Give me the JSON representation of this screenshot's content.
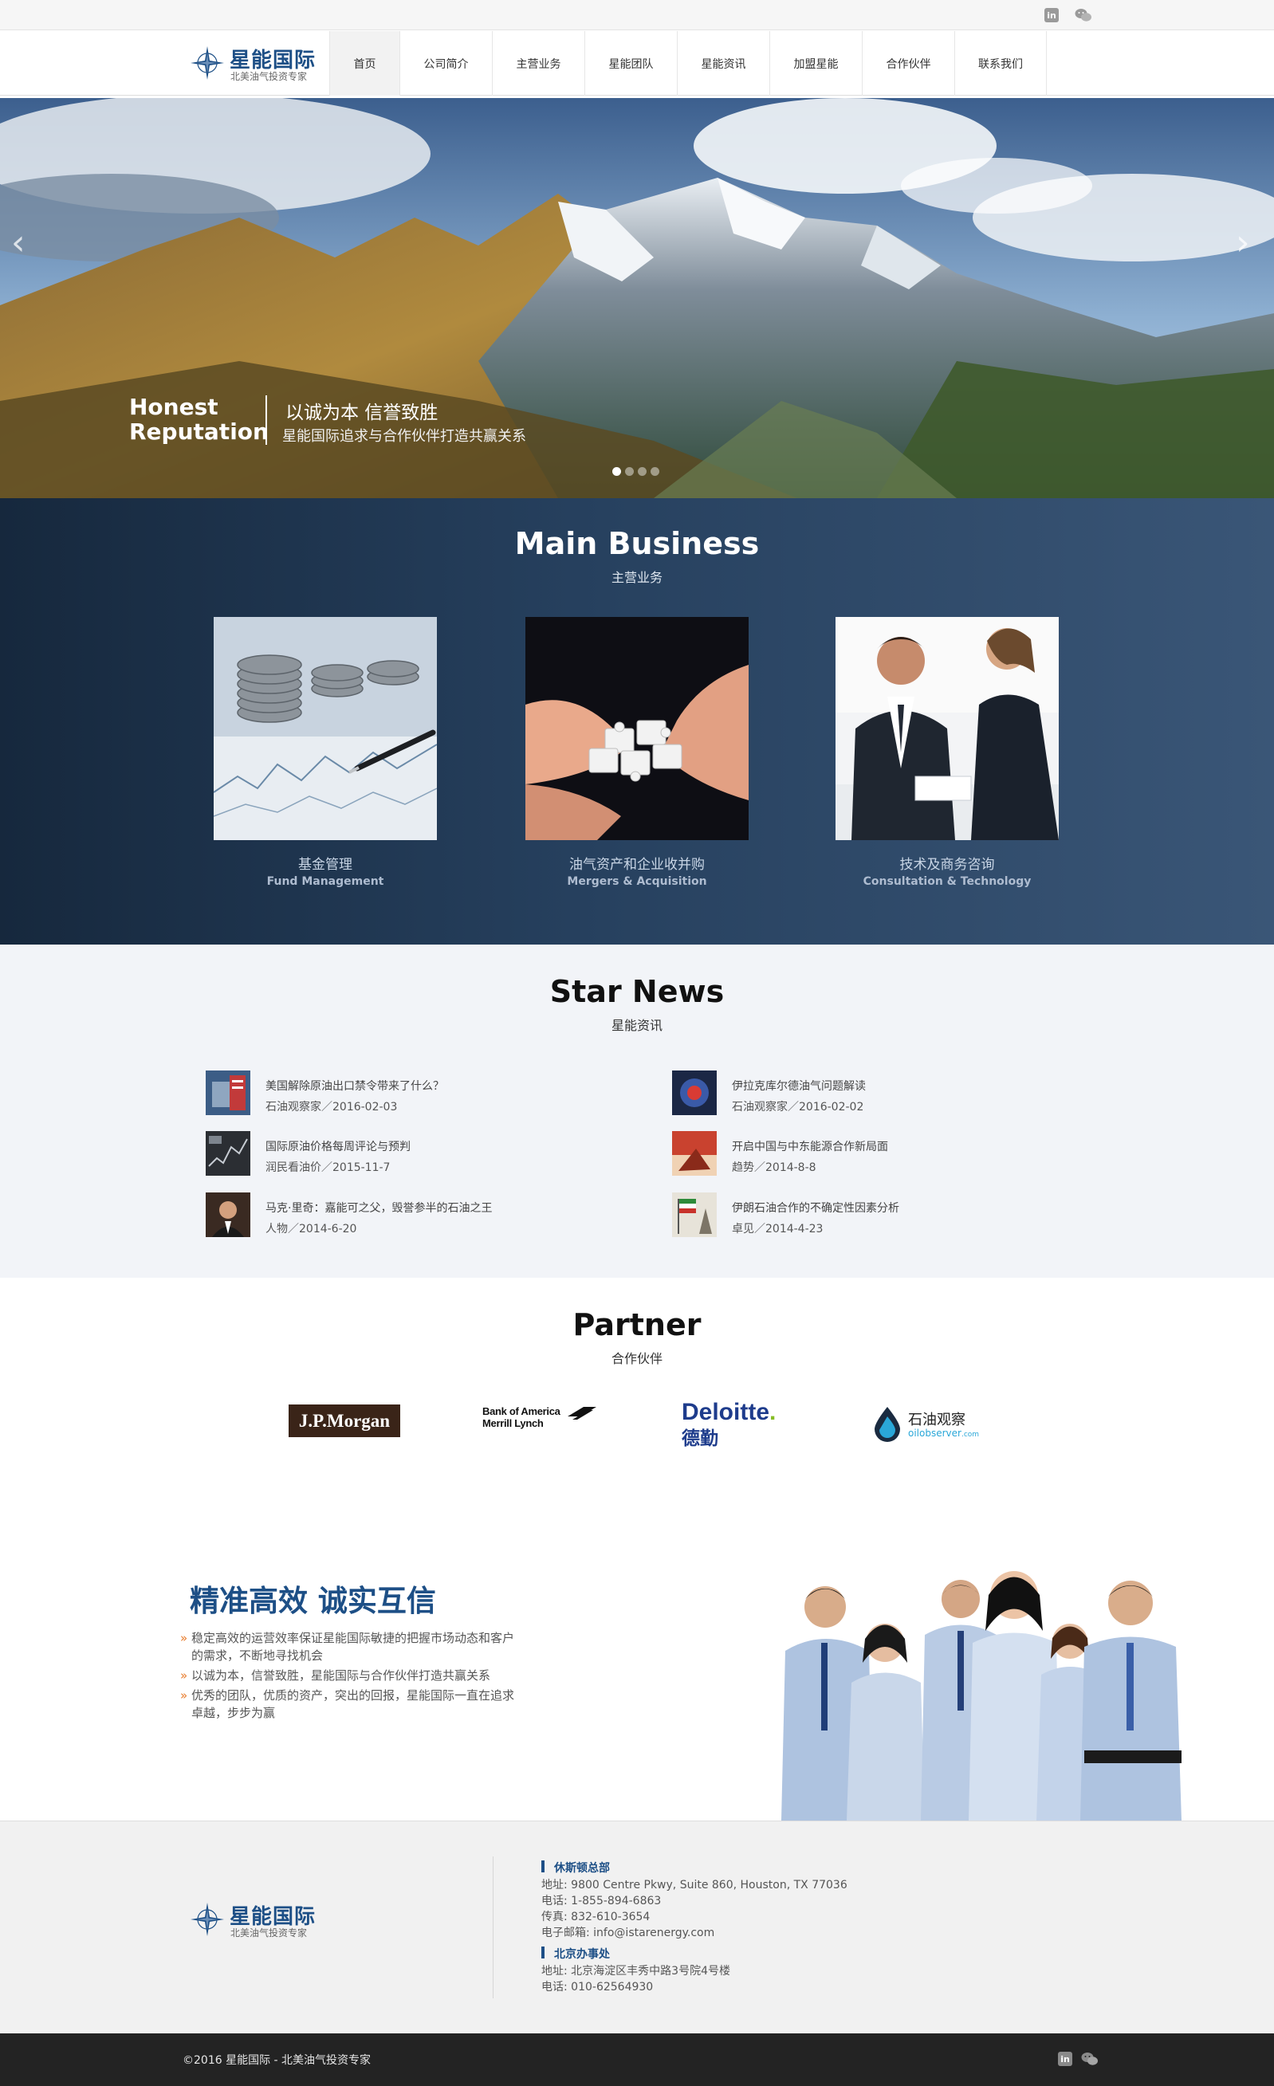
{
  "topbar": {
    "linkedin_icon_label": "in"
  },
  "brand": {
    "title": "星能国际",
    "subtitle": "北美油气投资专家"
  },
  "nav": {
    "items": [
      {
        "label": "首页",
        "active": true
      },
      {
        "label": "公司简介"
      },
      {
        "label": "主营业务"
      },
      {
        "label": "星能团队"
      },
      {
        "label": "星能资讯"
      },
      {
        "label": "加盟星能"
      },
      {
        "label": "合作伙伴"
      },
      {
        "label": "联系我们"
      }
    ]
  },
  "hero": {
    "en_line1": "Honest",
    "en_line2": "Reputation",
    "cn_title": "以诚为本 信誉致胜",
    "cn_sub": "星能国际追求与合作伙伴打造共赢关系",
    "slide_count": 4,
    "active_slide": 1
  },
  "business": {
    "title": "Main Business",
    "subtitle": "主营业务",
    "cards": [
      {
        "cn": "基金管理",
        "en": "Fund Management"
      },
      {
        "cn": "油气资产和企业收并购",
        "en": "Mergers & Acquisition"
      },
      {
        "cn": "技术及商务咨询",
        "en": "Consultation & Technology"
      }
    ]
  },
  "news": {
    "title": "Star News",
    "subtitle": "星能资讯",
    "items": [
      {
        "title": "美国解除原油出口禁令带来了什么？",
        "meta": "石油观察家／2016-02-03"
      },
      {
        "title": "伊拉克库尔德油气问题解读",
        "meta": "石油观察家／2016-02-02"
      },
      {
        "title": "国际原油价格每周评论与预判",
        "meta": "润民看油价／2015-11-7"
      },
      {
        "title": "开启中国与中东能源合作新局面",
        "meta": "趋势／2014-8-8"
      },
      {
        "title": "马克·里奇：嘉能可之父，毁誉参半的石油之王",
        "meta": "人物／2014-6-20"
      },
      {
        "title": "伊朗石油合作的不确定性因素分析",
        "meta": "卓见／2014-4-23"
      }
    ]
  },
  "partner": {
    "title": "Partner",
    "subtitle": "合作伙伴",
    "logos": {
      "jpmorgan": "J.P.Morgan",
      "boa_line1": "Bank of America",
      "boa_line2": "Merrill Lynch",
      "deloitte": "Deloitte",
      "deloitte_dot": ".",
      "deloitte_cn": "德勤",
      "oil_cn": "石油观察",
      "oil_en": "oilobserver",
      "oil_com": ".com"
    }
  },
  "slogan": {
    "title": "精准高效 诚实互信",
    "bullets": [
      {
        "line1": "稳定高效的运营效率保证星能国际敏捷的把握市场动态和客户",
        "line2": "的需求，不断地寻找机会"
      },
      {
        "line1": "以诚为本，信誉致胜，星能国际与合作伙伴打造共赢关系",
        "line2": ""
      },
      {
        "line1": "优秀的团队，优质的资产，突出的回报，星能国际一直在追求",
        "line2": "卓越，步步为赢"
      }
    ]
  },
  "footer": {
    "houston": {
      "heading": "休斯顿总部",
      "address": "地址: 9800 Centre Pkwy, Suite 860, Houston, TX 77036",
      "phone": "电话: 1-855-894-6863",
      "fax": "传真: 832-610-3654",
      "email": "电子邮箱: info@istarenergy.com"
    },
    "beijing": {
      "heading": "北京办事处",
      "address": "地址: 北京海淀区丰秀中路3号院4号楼",
      "phone": "电话: 010-62564930"
    },
    "copyright": "©2016 星能国际  -  北美油气投资专家"
  },
  "colors": {
    "brand_blue": "#1d4f86",
    "business_bg": "#26405e",
    "news_bg": "#f2f4f8",
    "bullet_orange": "#e87a2a"
  }
}
